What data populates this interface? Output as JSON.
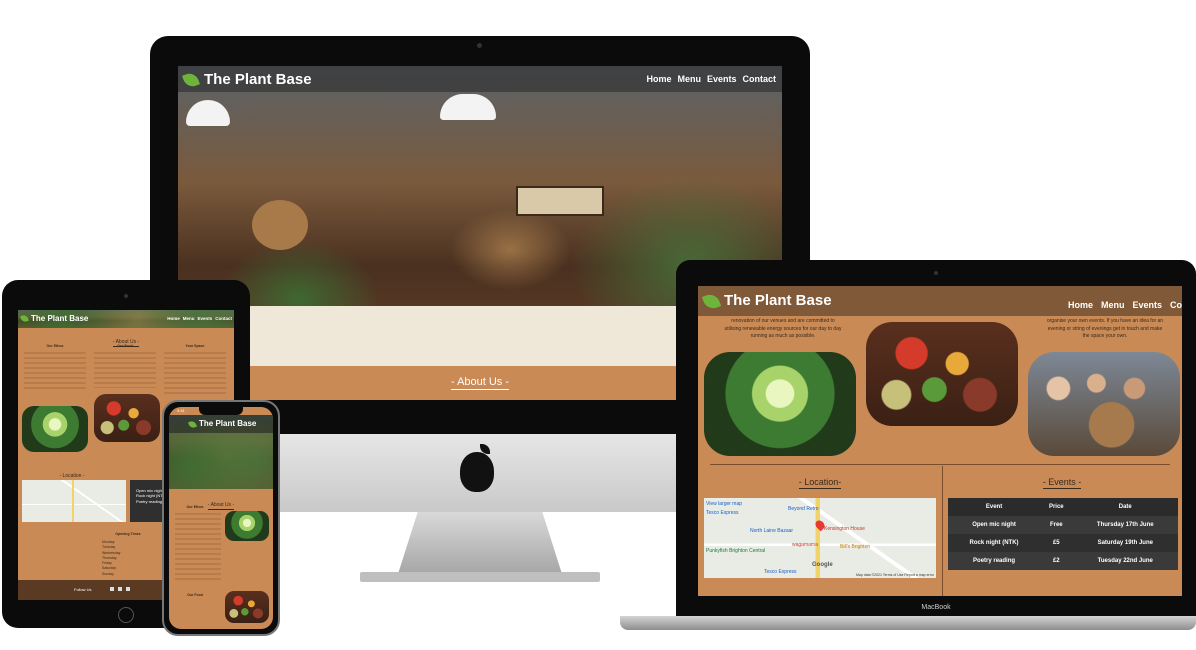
{
  "site": {
    "brand": "The Plant Base",
    "nav": [
      "Home",
      "Menu",
      "Events",
      "Contact"
    ]
  },
  "imac": {
    "section_title": "- About Us -"
  },
  "macbook": {
    "label": "MacBook",
    "intro_text": [
      "renovation of our venues and are committed to",
      "utilising renewable energy sources for our day to day",
      "running as much as possible.",
      "organise your own events. If you have an idea for an",
      "evening or string of evenings get in touch and make",
      "the space your own."
    ],
    "location_title": "- Location-",
    "events_title": "- Events -",
    "map_labels": [
      "View larger map",
      "Tesco Express",
      "Beyond Retro",
      "North Laine Bazaar",
      "Kensington House",
      "wagamama",
      "Bill's Brighton",
      "Punkyfish Brighton Central",
      "Tesco Express",
      "Google"
    ],
    "map_footer": "Map data ©2021  Terms of Use  Report a map error",
    "events_table": {
      "headers": [
        "Event",
        "Price",
        "Date"
      ],
      "rows": [
        [
          "Open mic night",
          "Free",
          "Thursday 17th June"
        ],
        [
          "Rock night (NTK)",
          "£5",
          "Saturday 19th June"
        ],
        [
          "Poetry reading",
          "£2",
          "Tuesday 22nd June"
        ]
      ]
    }
  },
  "ipad": {
    "about_title": "- About Us -",
    "col1_title": "Our Ethos",
    "col2_title": "Our Food",
    "col3_title": "Your Space",
    "location_title": "- Location -",
    "events_rows": [
      "Event",
      "Open mic night",
      "Rock night (NTK)",
      "Poetry reading"
    ],
    "opening_title": "Opening Times",
    "opening_days": [
      "Monday",
      "Tuesday",
      "Wednesday",
      "Thursday",
      "Friday",
      "Saturday",
      "Sunday"
    ],
    "footer_label": "Follow Us"
  },
  "iphone": {
    "time": "9:41",
    "about_title": "- About Us -",
    "ethos_title": "Our Ethos",
    "food_title": "Our Food"
  }
}
